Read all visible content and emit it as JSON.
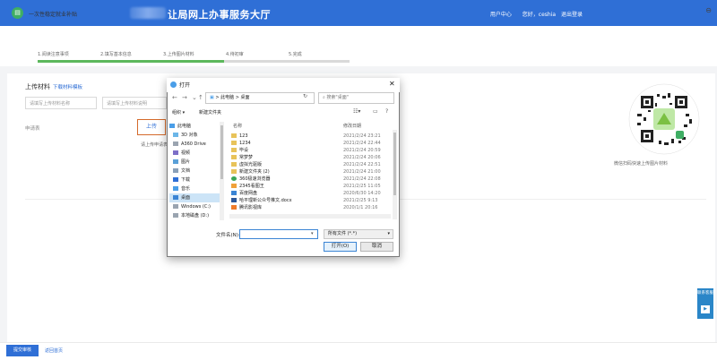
{
  "header": {
    "site_title": "让局网上办事服务大厅",
    "user_center": "用户中心",
    "welcome": "您好，ceshia",
    "logout": "退出登录",
    "bg_color": "#2f6fd6"
  },
  "service": {
    "name": "一次性稳定就业补贴",
    "icon": "service-icon"
  },
  "steps": [
    {
      "label": "1.阅读注意事项",
      "state": "done"
    },
    {
      "label": "2.填写基本信息",
      "state": "done"
    },
    {
      "label": "3.上传图片材料",
      "state": "active"
    },
    {
      "label": "4.待初审",
      "state": "todo"
    },
    {
      "label": "5.完成",
      "state": "todo"
    }
  ],
  "upload": {
    "title": "上传材料",
    "template_link": "下载材料模板",
    "name_placeholder": "请填写上传材料名称",
    "desc_placeholder": "请填写上传材料说明",
    "row_label": "申请表",
    "upload_button": "上传",
    "hint": "请上传申请表"
  },
  "qr": {
    "caption": "微信扫码快速上传图片材料"
  },
  "float_service": {
    "label": "联系客服"
  },
  "bottom": {
    "submit": "提交审核",
    "back": "返回首页"
  },
  "dialog": {
    "title": "打开",
    "address_path": [
      "此电脑",
      "桌面"
    ],
    "search_placeholder": "搜索\"桌面\"",
    "organize": "组织 ▾",
    "new_folder": "新建文件夹",
    "columns": {
      "name": "名称",
      "date": "修改日期"
    },
    "tree": [
      {
        "label": "此电脑",
        "icon": "computer-icon",
        "selected": false
      },
      {
        "label": "3D 对象",
        "icon": "cube-icon",
        "selected": false
      },
      {
        "label": "A360 Drive",
        "icon": "cloud-icon",
        "selected": false
      },
      {
        "label": "视频",
        "icon": "video-icon",
        "selected": false
      },
      {
        "label": "图片",
        "icon": "picture-icon",
        "selected": false
      },
      {
        "label": "文档",
        "icon": "document-icon",
        "selected": false
      },
      {
        "label": "下载",
        "icon": "download-icon",
        "selected": false
      },
      {
        "label": "音乐",
        "icon": "music-icon",
        "selected": false
      },
      {
        "label": "桌面",
        "icon": "desktop-icon",
        "selected": true
      },
      {
        "label": "Windows (C:)",
        "icon": "drive-icon",
        "selected": false
      },
      {
        "label": "本地磁盘 (D:)",
        "icon": "drive-icon",
        "selected": false
      }
    ],
    "files": [
      {
        "name": "123",
        "date": "2021/2/24 23:21",
        "icon": "folder-icon"
      },
      {
        "name": "1234",
        "date": "2021/2/24 22:44",
        "icon": "folder-icon"
      },
      {
        "name": "毕设",
        "date": "2021/2/24 20:59",
        "icon": "folder-icon"
      },
      {
        "name": "常梦梦",
        "date": "2021/2/24 20:06",
        "icon": "folder-icon"
      },
      {
        "name": "虚拟光驱版",
        "date": "2021/2/24 22:51",
        "icon": "folder-icon"
      },
      {
        "name": "新建文件夹 (2)",
        "date": "2021/2/24 21:00",
        "icon": "folder-icon"
      },
      {
        "name": "360极速浏览器",
        "date": "2021/2/24 22:08",
        "icon": "browser-icon"
      },
      {
        "name": "2345看图王",
        "date": "2021/2/25 11:05",
        "icon": "app-icon"
      },
      {
        "name": "百度网盘",
        "date": "2020/6/30 14:20",
        "icon": "app-icon"
      },
      {
        "name": "哈平理新公众号推文.docx",
        "date": "2021/2/25 9:13",
        "icon": "word-icon"
      },
      {
        "name": "腾讯影视库",
        "date": "2020/1/1 20:16",
        "icon": "app-icon"
      }
    ],
    "filename_label": "文件名(N):",
    "filename_value": "",
    "filetype": "所有文件 (*.*)",
    "open_button": "打开(O)",
    "cancel_button": "取消"
  }
}
